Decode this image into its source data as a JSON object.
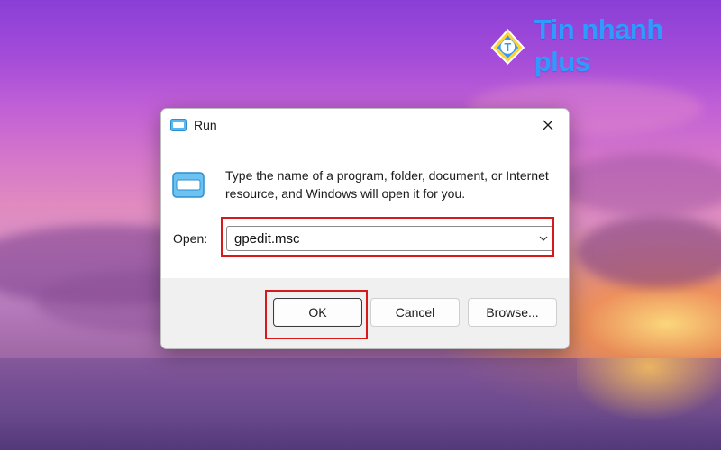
{
  "brand": {
    "name": "Tin nhanh plus",
    "icon": "logo-mark-icon",
    "color": "#2f9bff"
  },
  "dialog": {
    "title": "Run",
    "title_icon": "run-icon",
    "close_icon": "close-icon",
    "description": "Type the name of a program, folder, document, or Internet resource, and Windows will open it for you.",
    "open_label": "Open:",
    "open_value": "gpedit.msc",
    "dropdown_icon": "chevron-down-icon",
    "buttons": {
      "ok": "OK",
      "cancel": "Cancel",
      "browse": "Browse..."
    }
  },
  "colors": {
    "highlight": "#d61a1a",
    "dialog_bg": "#f0f0f0"
  }
}
